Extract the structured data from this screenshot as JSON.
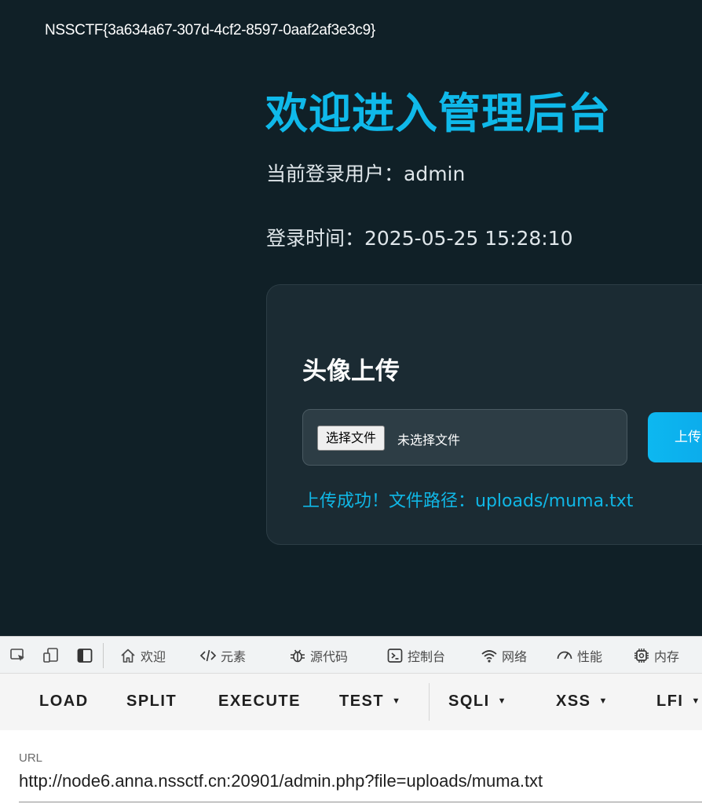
{
  "page": {
    "flag": "NSSCTF{3a634a67-307d-4cf2-8597-0aaf2af3e3c9}",
    "title": "欢迎进入管理后台",
    "user_line": "当前登录用户：admin",
    "time_line": "登录时间：2025-05-25 15:28:10",
    "colors": {
      "background": "#102027",
      "accent": "#0fb9ea",
      "card": "#1b2b33"
    }
  },
  "upload_card": {
    "title": "头像上传",
    "choose_label": "选择文件",
    "no_file_label": "未选择文件",
    "upload_label": "上传",
    "success_message": "上传成功！文件路径：uploads/muma.txt"
  },
  "devtools": {
    "tabs": [
      {
        "label": "欢迎",
        "icon": "home-icon"
      },
      {
        "label": "元素",
        "icon": "code-icon"
      },
      {
        "label": "源代码",
        "icon": "bug-icon"
      },
      {
        "label": "控制台",
        "icon": "console-icon"
      },
      {
        "label": "网络",
        "icon": "wifi-icon"
      },
      {
        "label": "性能",
        "icon": "gauge-icon"
      },
      {
        "label": "内存",
        "icon": "chip-icon"
      }
    ],
    "toolbar_icons": [
      "inspect-icon",
      "device-icon",
      "dock-icon"
    ]
  },
  "hackbar": {
    "buttons": [
      {
        "label": "LOAD",
        "dropdown": false
      },
      {
        "label": "SPLIT",
        "dropdown": false
      },
      {
        "label": "EXECUTE",
        "dropdown": false
      },
      {
        "label": "TEST",
        "dropdown": true
      },
      {
        "label": "SQLI",
        "dropdown": true
      },
      {
        "label": "XSS",
        "dropdown": true
      },
      {
        "label": "LFI",
        "dropdown": true
      }
    ]
  },
  "url_field": {
    "label": "URL",
    "value": "http://node6.anna.nssctf.cn:20901/admin.php?file=uploads/muma.txt"
  }
}
